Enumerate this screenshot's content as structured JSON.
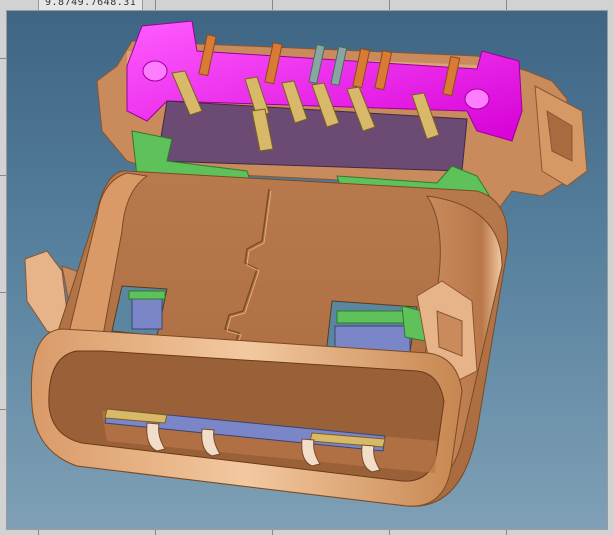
{
  "status": {
    "coordinates": "9.8749.7648.31"
  },
  "scene": {
    "subject": "usb-c-connector-3d-model"
  },
  "colors": {
    "background_top": "#3e6584",
    "background_bottom": "#7fa0b6",
    "shell": "#c9895a",
    "shell_light": "#e7b489",
    "shell_dark": "#8a5630",
    "insulator": "#ff27ff",
    "tongue": "#6b4a74",
    "green_part": "#5fc15a",
    "contact_blue": "#7b86c8",
    "pin_orange": "#d97a35",
    "pin_gray": "#8aa6a0"
  }
}
